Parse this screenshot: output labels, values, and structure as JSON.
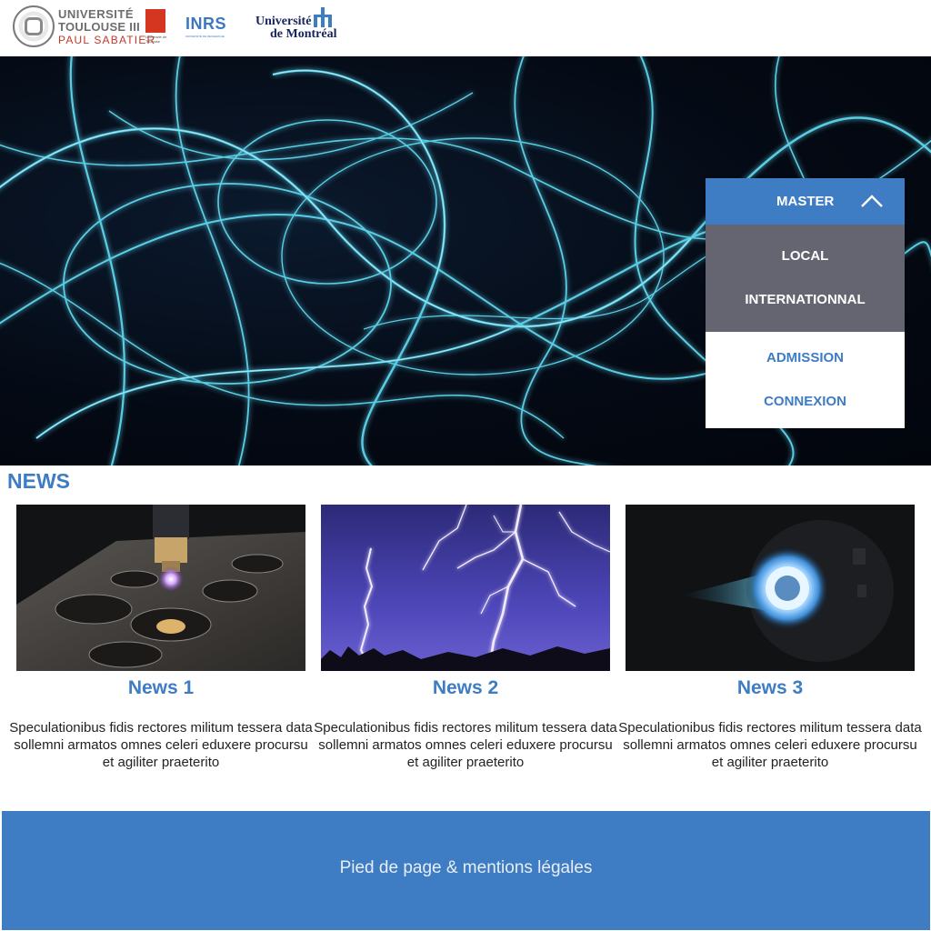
{
  "header": {
    "logo_ut3": {
      "line1": "UNIVERSITÉ",
      "line2": "TOULOUSE III",
      "line3": "PAUL SABATIER",
      "badge_text": "Université de Toulouse"
    },
    "logo_inrs": {
      "word": "INRS",
      "subtitle": "UNIVERSITÉ DE RECHERCHE"
    },
    "logo_udem": {
      "line1": "Université",
      "line2": "de Montréal"
    }
  },
  "menu": {
    "head_label": "MASTER",
    "sub_items": [
      "LOCAL",
      "INTERNATIONNAL"
    ],
    "main_items": [
      "ADMISSION",
      "CONNEXION"
    ]
  },
  "news": {
    "title": "NEWS",
    "items": [
      {
        "title": "News 1",
        "text": "Speculationibus fidis rectores militum tessera data sollemni armatos omnes celeri eduxere procursu et agiliter praeterito",
        "image": "plasma-cutter-image"
      },
      {
        "title": "News 2",
        "text": "Speculationibus fidis rectores militum tessera data sollemni armatos omnes celeri eduxere procursu et agiliter praeterito",
        "image": "lightning-image"
      },
      {
        "title": "News 3",
        "text": "Speculationibus fidis rectores militum tessera data sollemni armatos omnes celeri eduxere procursu et agiliter praeterito",
        "image": "ion-thruster-image"
      }
    ]
  },
  "footer": {
    "text": "Pied de page & mentions légales"
  },
  "colors": {
    "accent": "#3e7cc3",
    "menu_sub_bg": "#646570",
    "udem_navy": "#15245b",
    "ut3_red": "#c0392b"
  }
}
